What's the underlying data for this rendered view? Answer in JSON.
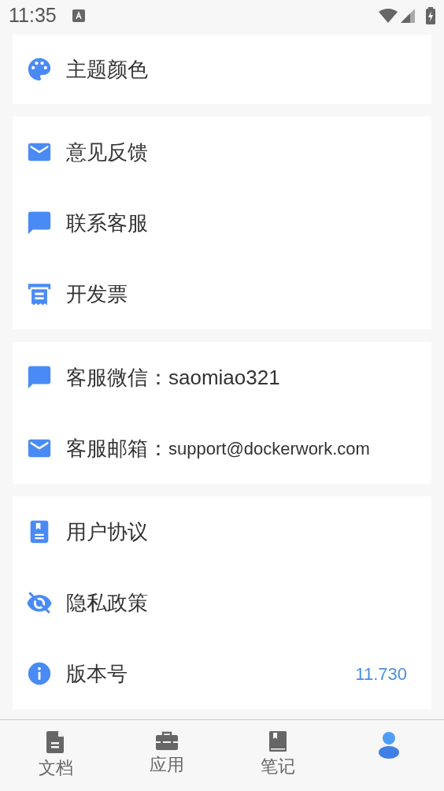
{
  "status_bar": {
    "time": "11:35"
  },
  "sections": [
    {
      "rows": [
        {
          "label": "主题颜色"
        }
      ]
    },
    {
      "rows": [
        {
          "label": "意见反馈"
        },
        {
          "label": "联系客服"
        },
        {
          "label": "开发票"
        }
      ]
    },
    {
      "rows": [
        {
          "label": "客服微信：",
          "value": "saomiao321"
        },
        {
          "label": "客服邮箱：",
          "value": "support@dockerwork.com"
        }
      ]
    },
    {
      "rows": [
        {
          "label": "用户协议"
        },
        {
          "label": "隐私政策"
        },
        {
          "label": "版本号",
          "trailing": "11.730"
        }
      ]
    }
  ],
  "bottom_nav": [
    {
      "label": "文档",
      "selected": false
    },
    {
      "label": "应用",
      "selected": false
    },
    {
      "label": "笔记",
      "selected": false
    },
    {
      "selected": true
    }
  ]
}
